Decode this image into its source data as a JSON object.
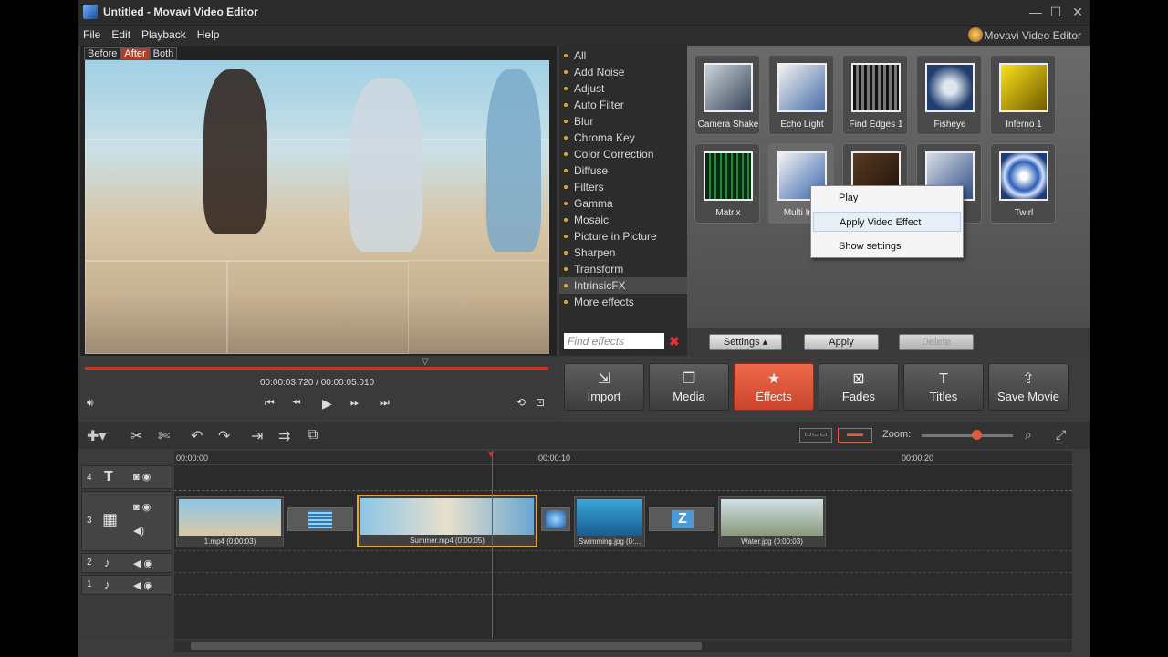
{
  "window": {
    "title": "Untitled - Movavi Video Editor",
    "brand": "Movavi Video Editor",
    "controls": [
      "—",
      "☐",
      "✕"
    ]
  },
  "menu": [
    "File",
    "Edit",
    "Playback",
    "Help"
  ],
  "preview": {
    "tabs": [
      "Before",
      "After",
      "Both"
    ],
    "active_tab": "After"
  },
  "effects_list": [
    "All",
    "Add Noise",
    "Adjust",
    "Auto Filter",
    "Blur",
    "Chroma Key",
    "Color Correction",
    "Diffuse",
    "Filters",
    "Gamma",
    "Mosaic",
    "Picture in Picture",
    "Sharpen",
    "Transform",
    "IntrinsicFX",
    "More effects"
  ],
  "effects_selected": "IntrinsicFX",
  "find_placeholder": "Find effects",
  "thumbnails": [
    "Camera Shake",
    "Echo Light",
    "Find Edges 1",
    "Fisheye",
    "Inferno 1",
    "Matrix",
    "Multi Ima",
    "",
    "",
    "Twirl"
  ],
  "context_menu": {
    "items": [
      "Play",
      "Apply Video Effect",
      "Show settings"
    ],
    "highlighted": "Apply Video Effect"
  },
  "effect_buttons": {
    "settings": "Settings ▴",
    "apply": "Apply",
    "delete": "Delete"
  },
  "transport": {
    "time": "00:00:03.720  /  00:00:05.010"
  },
  "big_buttons": [
    {
      "label": "Import",
      "icon": "⇲"
    },
    {
      "label": "Media",
      "icon": "❐"
    },
    {
      "label": "Effects",
      "icon": "★"
    },
    {
      "label": "Fades",
      "icon": "⊠"
    },
    {
      "label": "Titles",
      "icon": "T"
    },
    {
      "label": "Save Movie",
      "icon": "⇪"
    }
  ],
  "active_button": "Effects",
  "zoom_label": "Zoom:",
  "ruler": [
    "00:00:00",
    "00:00:10",
    "00:00:20"
  ],
  "tracks": [
    "4",
    "3",
    "2",
    "1"
  ],
  "clips": [
    {
      "label": "1.mp4 (0:00:03)"
    },
    {
      "label": "Summer.mp4 (0:00:05)"
    },
    {
      "label": "Swimming.jpg (0:..."
    },
    {
      "label": "Water.jpg (0:00:03)"
    }
  ],
  "colors": {
    "accent": "#e05a3b",
    "selection": "#e8a72a",
    "playhead": "#e03020"
  }
}
